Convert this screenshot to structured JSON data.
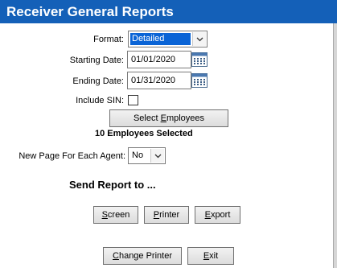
{
  "window": {
    "title": "Receiver General Reports"
  },
  "form": {
    "format": {
      "label": "Format:",
      "value": "Detailed"
    },
    "starting_date": {
      "label": "Starting Date:",
      "value": "01/01/2020"
    },
    "ending_date": {
      "label": "Ending Date:",
      "value": "01/31/2020"
    },
    "include_sin": {
      "label": "Include SIN:",
      "checked": false
    },
    "select_employees": {
      "label_pre": "Select ",
      "label_key": "E",
      "label_post": "mployees"
    },
    "employees_selected": "10 Employees Selected",
    "new_page": {
      "label": "New Page For Each Agent:",
      "value": "No"
    }
  },
  "send_report": {
    "heading": "Send Report to ...",
    "screen": {
      "key": "S",
      "rest": "creen"
    },
    "printer": {
      "key": "P",
      "rest": "rinter"
    },
    "export": {
      "key": "E",
      "rest": "xport"
    }
  },
  "footer": {
    "change_printer": {
      "key": "C",
      "rest": "hange Printer"
    },
    "exit": {
      "key": "E",
      "rest": "xit"
    }
  },
  "colors": {
    "title_bar": "#1460b8",
    "selection": "#0a64d6"
  },
  "icons": {
    "calendar": "calendar-icon",
    "dropdown": "chevron-down-icon"
  }
}
